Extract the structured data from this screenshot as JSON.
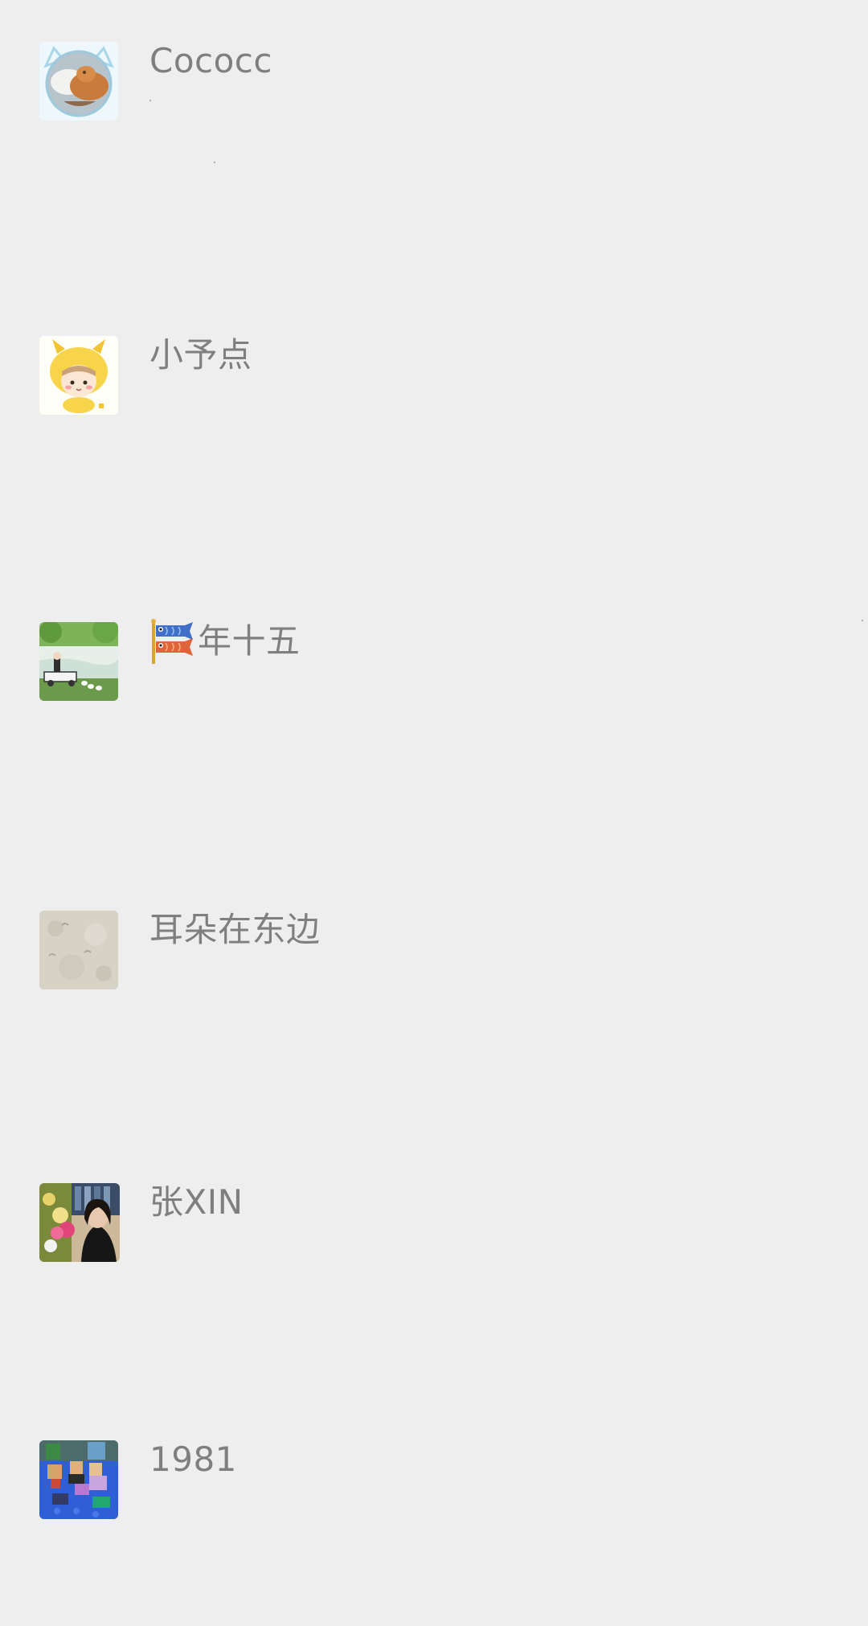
{
  "contacts": [
    {
      "name": "Cococc",
      "avatar": "cat-sleeping-avatar"
    },
    {
      "name": "小予点",
      "avatar": "cartoon-dragon-kid-avatar"
    },
    {
      "name": "年十五",
      "prefix_icon": "carp-streamer-flag-icon",
      "avatar": "lake-geese-illustration-avatar"
    },
    {
      "name": "耳朵在东边",
      "avatar": "sand-texture-avatar"
    },
    {
      "name": "张XIN",
      "avatar": "woman-with-flowers-avatar"
    },
    {
      "name": "1981",
      "avatar": "toy-figures-avatar"
    }
  ],
  "colors": {
    "background": "#eeeeee",
    "name_text": "#7f7f7f"
  }
}
